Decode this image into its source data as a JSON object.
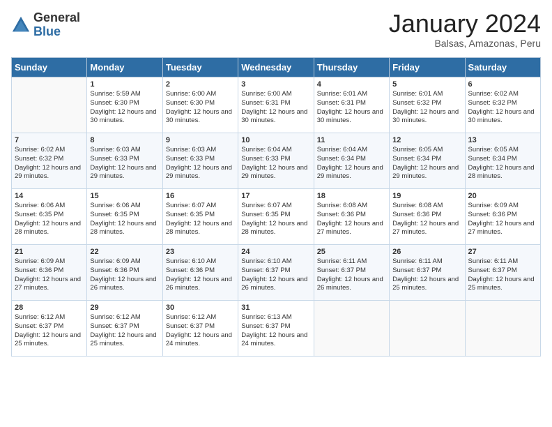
{
  "logo": {
    "general": "General",
    "blue": "Blue"
  },
  "header": {
    "month": "January 2024",
    "location": "Balsas, Amazonas, Peru"
  },
  "days_of_week": [
    "Sunday",
    "Monday",
    "Tuesday",
    "Wednesday",
    "Thursday",
    "Friday",
    "Saturday"
  ],
  "weeks": [
    [
      {
        "day": "",
        "sunrise": "",
        "sunset": "",
        "daylight": ""
      },
      {
        "day": "1",
        "sunrise": "Sunrise: 5:59 AM",
        "sunset": "Sunset: 6:30 PM",
        "daylight": "Daylight: 12 hours and 30 minutes."
      },
      {
        "day": "2",
        "sunrise": "Sunrise: 6:00 AM",
        "sunset": "Sunset: 6:30 PM",
        "daylight": "Daylight: 12 hours and 30 minutes."
      },
      {
        "day": "3",
        "sunrise": "Sunrise: 6:00 AM",
        "sunset": "Sunset: 6:31 PM",
        "daylight": "Daylight: 12 hours and 30 minutes."
      },
      {
        "day": "4",
        "sunrise": "Sunrise: 6:01 AM",
        "sunset": "Sunset: 6:31 PM",
        "daylight": "Daylight: 12 hours and 30 minutes."
      },
      {
        "day": "5",
        "sunrise": "Sunrise: 6:01 AM",
        "sunset": "Sunset: 6:32 PM",
        "daylight": "Daylight: 12 hours and 30 minutes."
      },
      {
        "day": "6",
        "sunrise": "Sunrise: 6:02 AM",
        "sunset": "Sunset: 6:32 PM",
        "daylight": "Daylight: 12 hours and 30 minutes."
      }
    ],
    [
      {
        "day": "7",
        "sunrise": "Sunrise: 6:02 AM",
        "sunset": "Sunset: 6:32 PM",
        "daylight": "Daylight: 12 hours and 29 minutes."
      },
      {
        "day": "8",
        "sunrise": "Sunrise: 6:03 AM",
        "sunset": "Sunset: 6:33 PM",
        "daylight": "Daylight: 12 hours and 29 minutes."
      },
      {
        "day": "9",
        "sunrise": "Sunrise: 6:03 AM",
        "sunset": "Sunset: 6:33 PM",
        "daylight": "Daylight: 12 hours and 29 minutes."
      },
      {
        "day": "10",
        "sunrise": "Sunrise: 6:04 AM",
        "sunset": "Sunset: 6:33 PM",
        "daylight": "Daylight: 12 hours and 29 minutes."
      },
      {
        "day": "11",
        "sunrise": "Sunrise: 6:04 AM",
        "sunset": "Sunset: 6:34 PM",
        "daylight": "Daylight: 12 hours and 29 minutes."
      },
      {
        "day": "12",
        "sunrise": "Sunrise: 6:05 AM",
        "sunset": "Sunset: 6:34 PM",
        "daylight": "Daylight: 12 hours and 29 minutes."
      },
      {
        "day": "13",
        "sunrise": "Sunrise: 6:05 AM",
        "sunset": "Sunset: 6:34 PM",
        "daylight": "Daylight: 12 hours and 28 minutes."
      }
    ],
    [
      {
        "day": "14",
        "sunrise": "Sunrise: 6:06 AM",
        "sunset": "Sunset: 6:35 PM",
        "daylight": "Daylight: 12 hours and 28 minutes."
      },
      {
        "day": "15",
        "sunrise": "Sunrise: 6:06 AM",
        "sunset": "Sunset: 6:35 PM",
        "daylight": "Daylight: 12 hours and 28 minutes."
      },
      {
        "day": "16",
        "sunrise": "Sunrise: 6:07 AM",
        "sunset": "Sunset: 6:35 PM",
        "daylight": "Daylight: 12 hours and 28 minutes."
      },
      {
        "day": "17",
        "sunrise": "Sunrise: 6:07 AM",
        "sunset": "Sunset: 6:35 PM",
        "daylight": "Daylight: 12 hours and 28 minutes."
      },
      {
        "day": "18",
        "sunrise": "Sunrise: 6:08 AM",
        "sunset": "Sunset: 6:36 PM",
        "daylight": "Daylight: 12 hours and 27 minutes."
      },
      {
        "day": "19",
        "sunrise": "Sunrise: 6:08 AM",
        "sunset": "Sunset: 6:36 PM",
        "daylight": "Daylight: 12 hours and 27 minutes."
      },
      {
        "day": "20",
        "sunrise": "Sunrise: 6:09 AM",
        "sunset": "Sunset: 6:36 PM",
        "daylight": "Daylight: 12 hours and 27 minutes."
      }
    ],
    [
      {
        "day": "21",
        "sunrise": "Sunrise: 6:09 AM",
        "sunset": "Sunset: 6:36 PM",
        "daylight": "Daylight: 12 hours and 27 minutes."
      },
      {
        "day": "22",
        "sunrise": "Sunrise: 6:09 AM",
        "sunset": "Sunset: 6:36 PM",
        "daylight": "Daylight: 12 hours and 26 minutes."
      },
      {
        "day": "23",
        "sunrise": "Sunrise: 6:10 AM",
        "sunset": "Sunset: 6:36 PM",
        "daylight": "Daylight: 12 hours and 26 minutes."
      },
      {
        "day": "24",
        "sunrise": "Sunrise: 6:10 AM",
        "sunset": "Sunset: 6:37 PM",
        "daylight": "Daylight: 12 hours and 26 minutes."
      },
      {
        "day": "25",
        "sunrise": "Sunrise: 6:11 AM",
        "sunset": "Sunset: 6:37 PM",
        "daylight": "Daylight: 12 hours and 26 minutes."
      },
      {
        "day": "26",
        "sunrise": "Sunrise: 6:11 AM",
        "sunset": "Sunset: 6:37 PM",
        "daylight": "Daylight: 12 hours and 25 minutes."
      },
      {
        "day": "27",
        "sunrise": "Sunrise: 6:11 AM",
        "sunset": "Sunset: 6:37 PM",
        "daylight": "Daylight: 12 hours and 25 minutes."
      }
    ],
    [
      {
        "day": "28",
        "sunrise": "Sunrise: 6:12 AM",
        "sunset": "Sunset: 6:37 PM",
        "daylight": "Daylight: 12 hours and 25 minutes."
      },
      {
        "day": "29",
        "sunrise": "Sunrise: 6:12 AM",
        "sunset": "Sunset: 6:37 PM",
        "daylight": "Daylight: 12 hours and 25 minutes."
      },
      {
        "day": "30",
        "sunrise": "Sunrise: 6:12 AM",
        "sunset": "Sunset: 6:37 PM",
        "daylight": "Daylight: 12 hours and 24 minutes."
      },
      {
        "day": "31",
        "sunrise": "Sunrise: 6:13 AM",
        "sunset": "Sunset: 6:37 PM",
        "daylight": "Daylight: 12 hours and 24 minutes."
      },
      {
        "day": "",
        "sunrise": "",
        "sunset": "",
        "daylight": ""
      },
      {
        "day": "",
        "sunrise": "",
        "sunset": "",
        "daylight": ""
      },
      {
        "day": "",
        "sunrise": "",
        "sunset": "",
        "daylight": ""
      }
    ]
  ]
}
